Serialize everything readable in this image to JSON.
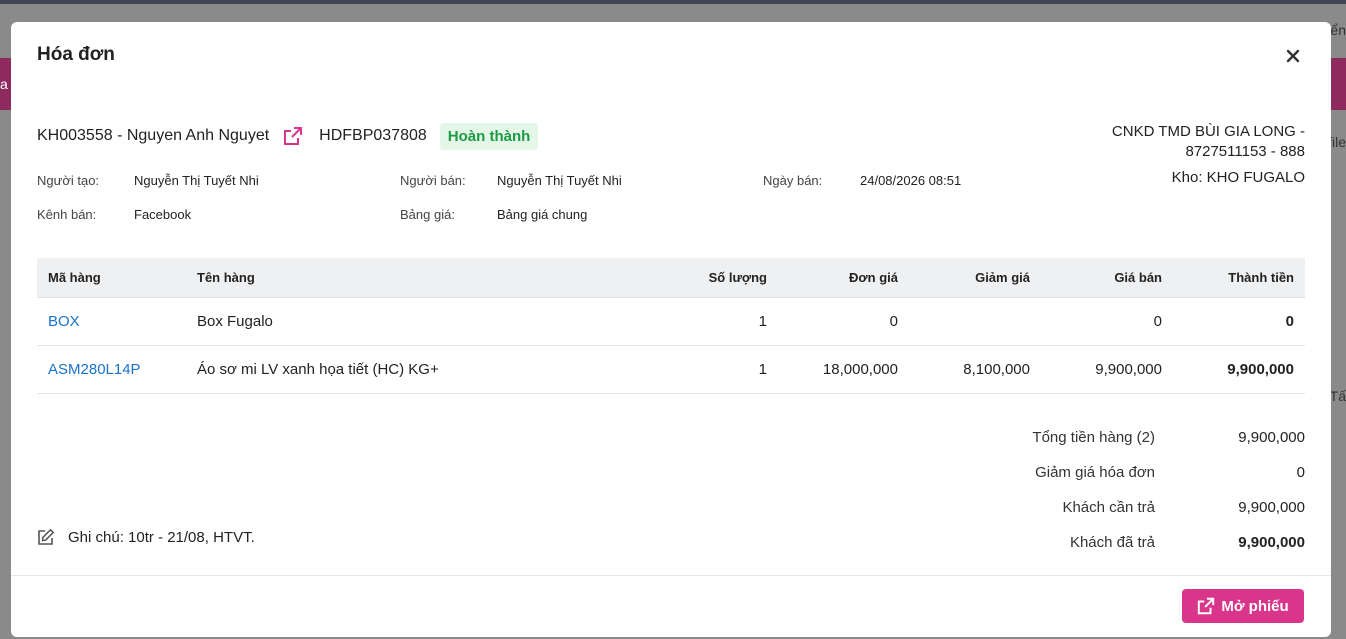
{
  "modal": {
    "title": "Hóa đơn"
  },
  "invoice": {
    "customer": "KH003558 - Nguyen Anh Nguyet",
    "code": "HDFBP037808",
    "status": "Hoàn thành",
    "branch_line1": "CNKD TMD BÙI GIA LONG -",
    "branch_line2": "8727511153 - 888",
    "warehouse": "Kho: KHO FUGALO",
    "creator_label": "Người tạo:",
    "creator": "Nguyễn Thị Tuyết Nhi",
    "seller_label": "Người bán:",
    "seller": "Nguyễn Thị Tuyết Nhi",
    "date_label": "Ngày bán:",
    "date": "24/08/2026 08:51",
    "channel_label": "Kênh bán:",
    "channel": "Facebook",
    "pricelist_label": "Bảng giá:",
    "pricelist": "Bảng giá chung"
  },
  "table": {
    "headers": {
      "code": "Mã hàng",
      "name": "Tên hàng",
      "qty": "Số lượng",
      "price": "Đơn giá",
      "discount": "Giảm giá",
      "sale": "Giá bán",
      "total": "Thành tiền"
    },
    "rows": [
      {
        "code": "BOX",
        "name": "Box Fugalo",
        "qty": "1",
        "price": "0",
        "discount": "",
        "sale": "0",
        "total": "0"
      },
      {
        "code": "ASM280L14P",
        "name": "Áo sơ mi LV xanh họa tiết (HC) KG+",
        "qty": "1",
        "price": "18,000,000",
        "discount": "8,100,000",
        "sale": "9,900,000",
        "total": "9,900,000"
      }
    ]
  },
  "summary": {
    "subtotal_label": "Tổng tiền hàng (2)",
    "subtotal": "9,900,000",
    "invoice_discount_label": "Giảm giá hóa đơn",
    "invoice_discount": "0",
    "due_label": "Khách cần trả",
    "due": "9,900,000",
    "paid_label": "Khách đã trả",
    "paid": "9,900,000"
  },
  "note": {
    "text": "Ghi chú: 10tr - 21/08, HTVT."
  },
  "footer": {
    "open_label": "Mở phiếu"
  },
  "background": {
    "frag1": "ển",
    "frag2": "a",
    "frag3": "file",
    "frag4": "Tấ"
  },
  "colors": {
    "accent": "#d9358a",
    "status_green": "#1e9a45",
    "link_blue": "#1b72c9"
  }
}
